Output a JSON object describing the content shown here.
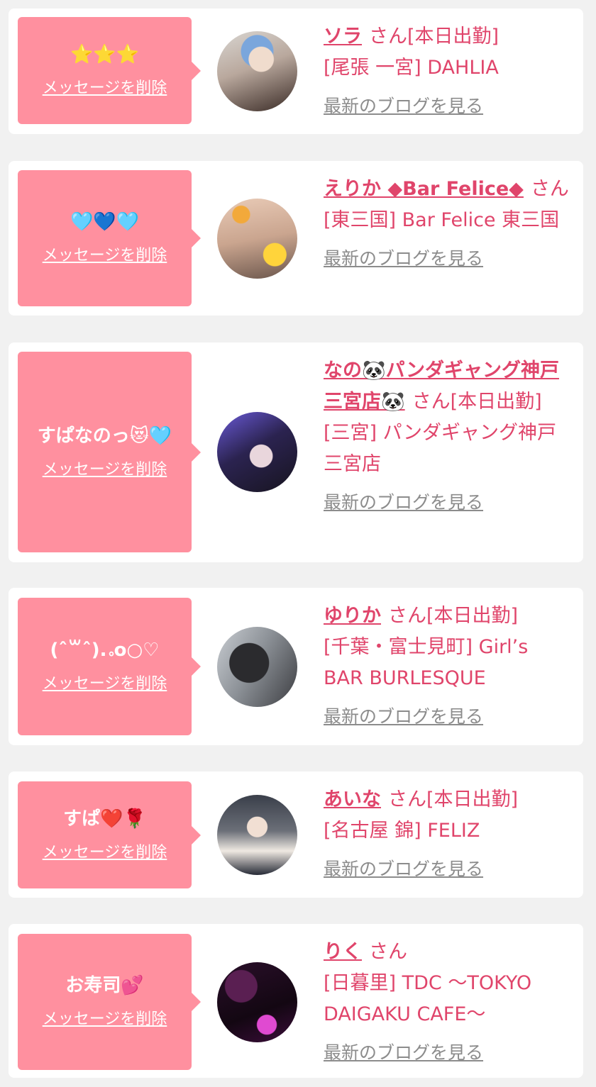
{
  "delete_label": "メッセージを削除",
  "blog_label": "最新のブログを見る",
  "colors": {
    "bubble": "#ff909f",
    "accent": "#e0456b",
    "link_gray": "#8c8c8c",
    "background": "#f1f1f1"
  },
  "cards": [
    {
      "message": "⭐⭐⭐",
      "name": "ソラ",
      "honorific": "さん",
      "status": "[本日出勤]",
      "shop": "[尾張 一宮] DAHLIA",
      "avatar_icon": "profile-photo"
    },
    {
      "message": "🩵💙🩵",
      "name": "えりか ◆Bar Felice◆",
      "honorific": "さん",
      "status": "",
      "shop": "[東三国] Bar Felice 東三国",
      "avatar_icon": "profile-photo"
    },
    {
      "message": "すぱなのっ😻🩵",
      "name": "なの🐼パンダギャング神戸三宮店🐼",
      "honorific": "さん",
      "status": "[本日出勤]",
      "shop": "[三宮] パンダギャング神戸三宮店",
      "avatar_icon": "profile-photo"
    },
    {
      "message": "(ˆ꒳ˆ).｡o○♡",
      "name": "ゆりか",
      "honorific": "さん",
      "status": "[本日出勤]",
      "shop": "[千葉・富士見町] Girl’s BAR BURLESQUE",
      "avatar_icon": "profile-photo"
    },
    {
      "message": "すぱ❤️🌹",
      "name": "あいな",
      "honorific": "さん",
      "status": "[本日出勤]",
      "shop": "[名古屋 錦] FELIZ",
      "avatar_icon": "profile-photo"
    },
    {
      "message": "お寿司💕",
      "name": "りく",
      "honorific": "さん",
      "status": "",
      "shop": "[日暮里] TDC 〜TOKYO DAIGAKU CAFE〜",
      "avatar_icon": "profile-photo"
    }
  ]
}
